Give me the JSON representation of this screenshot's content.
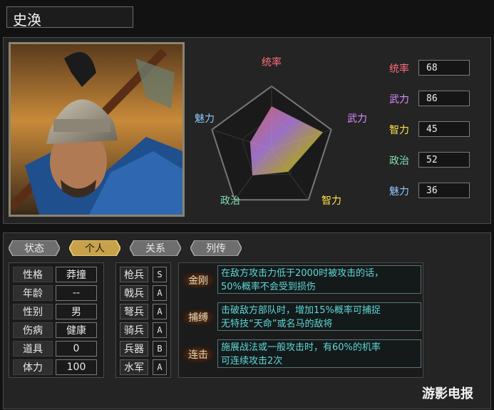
{
  "character": {
    "name": "史涣"
  },
  "radar": {
    "labels": {
      "command": "统率",
      "war": "武力",
      "intelligence": "智力",
      "politics": "政治",
      "charm": "魅力"
    }
  },
  "stats": [
    {
      "label": "统率",
      "value": "68",
      "color": "#ff6d7d"
    },
    {
      "label": "武力",
      "value": "86",
      "color": "#d98cff"
    },
    {
      "label": "智力",
      "value": "45",
      "color": "#ffe24a"
    },
    {
      "label": "政治",
      "value": "52",
      "color": "#7fe0b0"
    },
    {
      "label": "魅力",
      "value": "36",
      "color": "#8cc8ff"
    }
  ],
  "tabs": [
    {
      "label": "状态"
    },
    {
      "label": "个人"
    },
    {
      "label": "关系"
    },
    {
      "label": "列传"
    }
  ],
  "active_tab": "个人",
  "personal": [
    {
      "label": "性格",
      "value": "莽撞"
    },
    {
      "label": "年龄",
      "value": "--"
    },
    {
      "label": "性别",
      "value": "男"
    },
    {
      "label": "伤病",
      "value": "健康"
    },
    {
      "label": "道具",
      "value": "0"
    },
    {
      "label": "体力",
      "value": "100"
    }
  ],
  "troops": [
    {
      "label": "枪兵",
      "value": "S"
    },
    {
      "label": "戟兵",
      "value": "A"
    },
    {
      "label": "弩兵",
      "value": "A"
    },
    {
      "label": "骑兵",
      "value": "A"
    },
    {
      "label": "兵器",
      "value": "B"
    },
    {
      "label": "水军",
      "value": "A"
    }
  ],
  "skills": [
    {
      "name": "金刚",
      "desc1": "在敌方攻击力低于2000时被攻击的话，",
      "desc2": "50%概率不会受到损伤"
    },
    {
      "name": "捕缚",
      "desc1": "击破敌方部队时，增加15%概率可捕捉",
      "desc2": "无特技“天命”或名马的敌将"
    },
    {
      "name": "连击",
      "desc1": "施展战法或一般攻击时，有60%的机率",
      "desc2": "可连续攻击2次"
    }
  ],
  "watermark": "游影电报"
}
